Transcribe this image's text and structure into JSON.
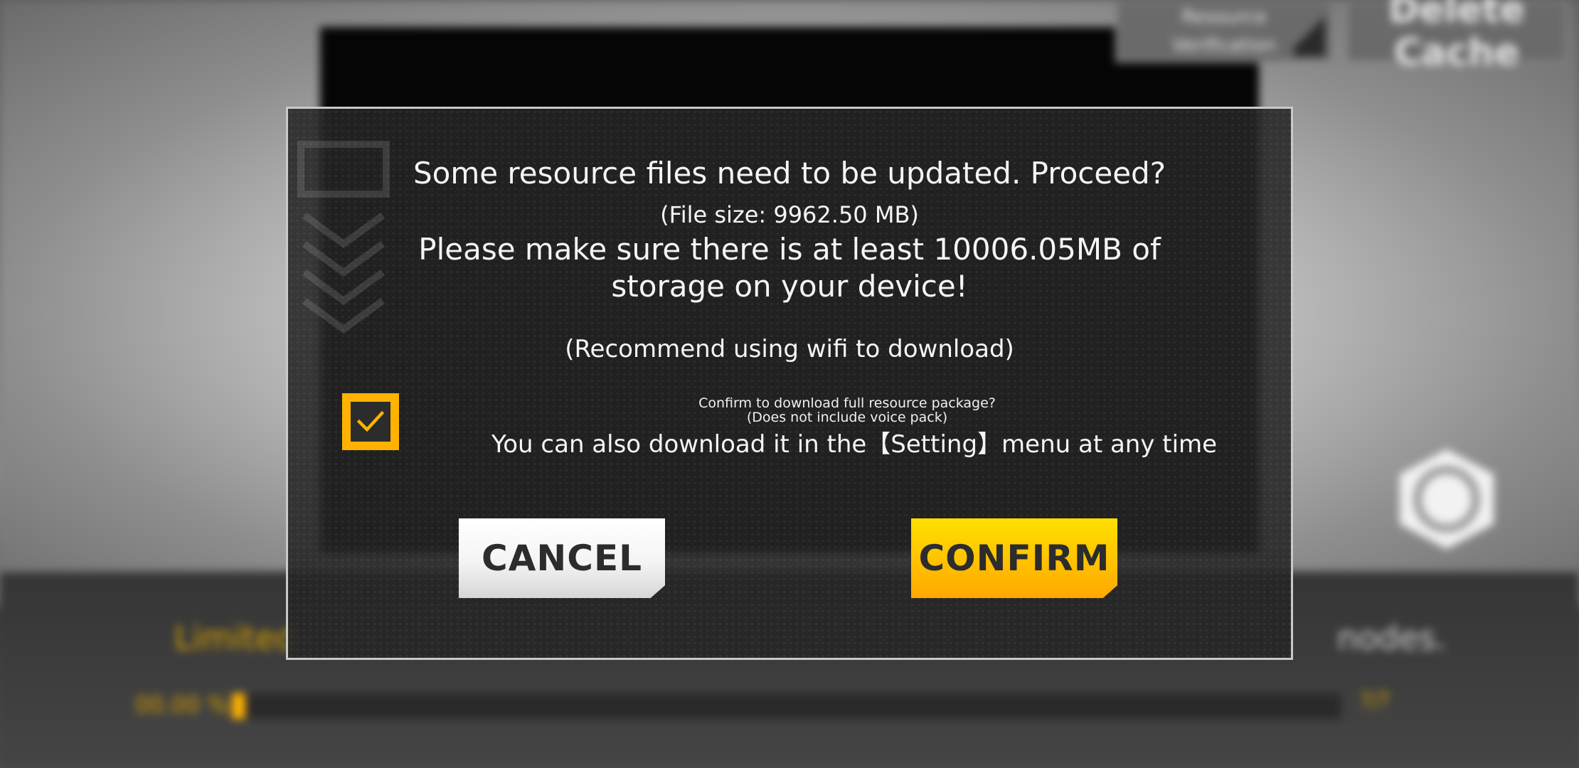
{
  "background": {
    "top_buttons": {
      "resource_verification": "Resource Verification",
      "delete_cache": "Delete Cache"
    },
    "tip_text_start": "Limited",
    "tip_text_end": "nodes.",
    "progress": {
      "percent_label": "00.00 %",
      "count_label": "?/?",
      "value": 0.0
    }
  },
  "dialog": {
    "title": "Some resource files need to be updated. Proceed?",
    "file_size": "(File size: 9962.50 MB)",
    "storage_notice": "Please make sure there is at least 10006.05MB of storage on your device!",
    "wifi_hint": "(Recommend using wifi to download)",
    "full_package": {
      "checked": true,
      "question": "Confirm to download full resource package?",
      "note": "(Does not include voice pack)",
      "settings_hint": "You can also download it in the【Setting】menu at any time"
    },
    "buttons": {
      "cancel": "CANCEL",
      "confirm": "CONFIRM"
    }
  },
  "colors": {
    "accent": "#ffb300",
    "dialog_bg": "#262626",
    "text": "#f5f5f5"
  },
  "icons": {
    "checkbox": "check-icon",
    "background_logo": "hexagon-refresh-icon"
  }
}
